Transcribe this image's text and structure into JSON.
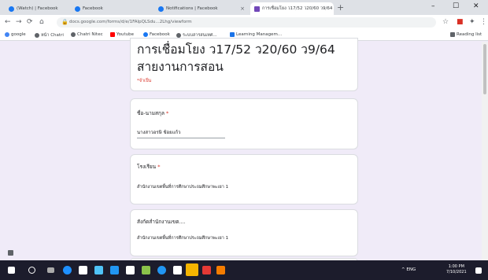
{
  "browser": {
    "tabs": [
      {
        "label": "(Watch) | Facebook",
        "active": false
      },
      {
        "label": "Facebook",
        "active": false
      },
      {
        "label": "Notifications | Facebook",
        "active": false
      },
      {
        "label": "การเชื่อมโยง ว17/52 ว20/60 ว9/64 - x",
        "active": true
      }
    ],
    "new_tab": "+",
    "window_controls": [
      "–",
      "☐",
      "✕"
    ],
    "url": "docs.google.com/forms/d/e/1FAIpQLSdu...2Lhg/viewform",
    "bookmarks": [
      "google",
      "หน้า Chatri",
      "Chatri Nitec",
      "Youtube",
      "Facebook",
      "ระบบสารสนเทศ...",
      "Learning Managem...",
      "Reading list"
    ]
  },
  "form": {
    "title": "การเชื่อมโยง ว17/52 ว20/60 ว9/64 สายงานการสอน",
    "required_note": "*จำเป็น",
    "questions": [
      {
        "label": "ชื่อ-นามสกุล",
        "required": "*",
        "answer": "นางสาวอรษิ ช้อยแก้ว"
      },
      {
        "label": "โรงเรียน",
        "required": "*",
        "answer": "สำนักงานเขตพื้นที่การศึกษาประถมศึกษาพะเยา 1"
      },
      {
        "label": "สังกัดสำนักงานเขต....",
        "required": "",
        "answer": "สำนักงานเขตพื้นที่การศึกษาประถมศึกษาพะเยา 1"
      }
    ]
  },
  "taskbar": {
    "tray_text": "^ ENG",
    "time": "1:00 PM",
    "date": "7/10/2021"
  }
}
